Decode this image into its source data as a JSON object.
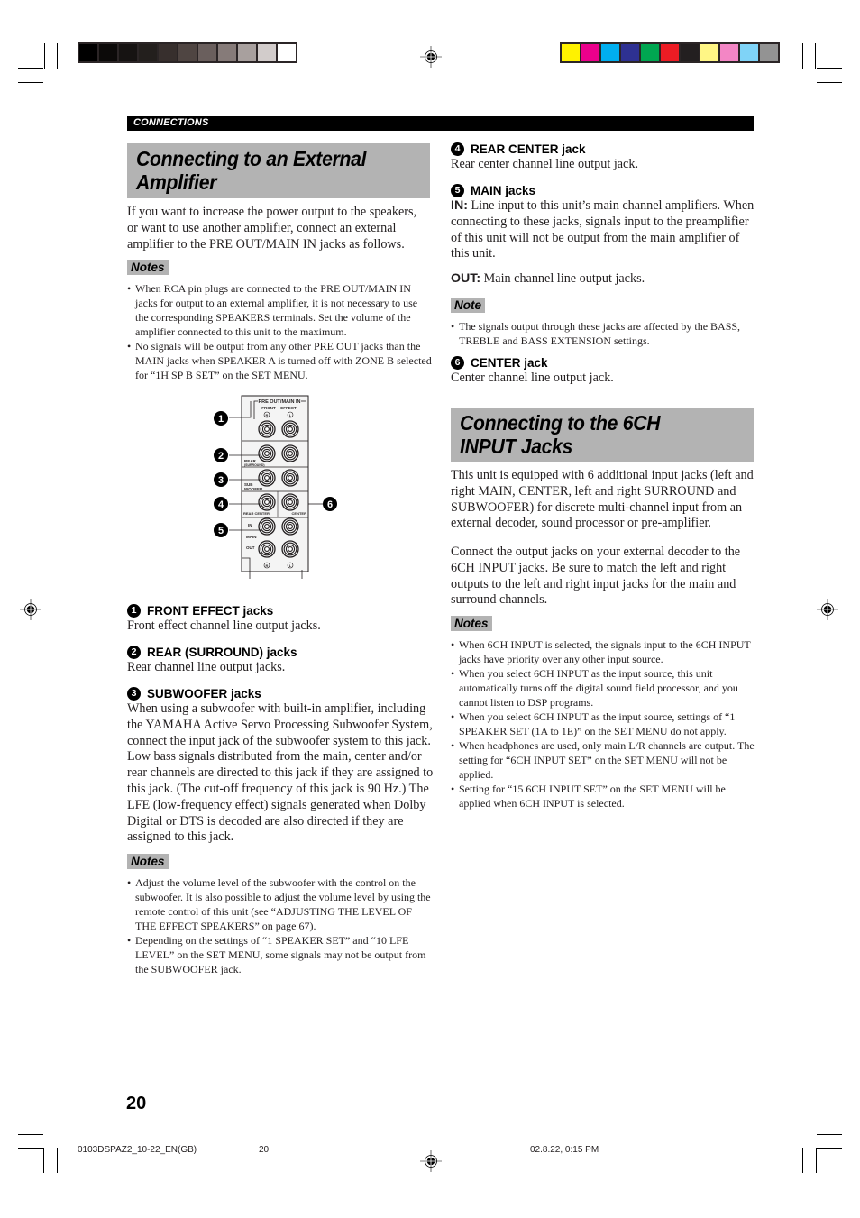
{
  "color_bars": {
    "grayscale": [
      "#000000",
      "#0c0a09",
      "#161312",
      "#231f1d",
      "#372f2d",
      "#4f4542",
      "#6a5f5d",
      "#867b79",
      "#a8a09e",
      "#d2cccb",
      "#ffffff"
    ],
    "process": [
      "#fff200",
      "#ec008c",
      "#00aeef",
      "#2e3192",
      "#00a651",
      "#ed1c24",
      "#231f20",
      "#fff685",
      "#f386c5",
      "#7fd3f7",
      "#939393"
    ]
  },
  "header": {
    "section": "CONNECTIONS"
  },
  "left": {
    "title": "Connecting to an External Amplifier",
    "intro": "If you want to increase the power output to the speakers, or want to use another amplifier, connect an external amplifier to the PRE OUT/MAIN IN jacks as follows.",
    "notes1": {
      "label": "Notes",
      "items": [
        "When RCA pin plugs are connected to the PRE OUT/MAIN IN jacks for output to an external amplifier, it is not necessary to use the corresponding SPEAKERS terminals. Set the volume of the amplifier connected to this unit to the maximum.",
        "No signals will be output from any other PRE OUT jacks than the MAIN jacks when SPEAKER A is turned off with ZONE B selected for “1H SP B SET” on the SET MENU."
      ]
    },
    "diagram": {
      "panel_title": "PRE OUT/MAIN IN",
      "front": "FRONT",
      "effect": "EFFECT",
      "rear": "REAR",
      "surround": "(SURROUND)",
      "sub": "SUB",
      "woofer": "WOOFER",
      "rear_center": "REAR CENTER",
      "center": "CENTER",
      "in": "IN",
      "main": "MAIN",
      "out": "OUT",
      "r": "R",
      "l": "L",
      "callouts": [
        "1",
        "2",
        "3",
        "4",
        "5",
        "6"
      ]
    },
    "sections": [
      {
        "num": "1",
        "heading": "FRONT EFFECT jacks",
        "text": "Front effect channel line output jacks."
      },
      {
        "num": "2",
        "heading": "REAR (SURROUND) jacks",
        "text": "Rear channel line output jacks."
      },
      {
        "num": "3",
        "heading": "SUBWOOFER jacks",
        "text": "When using a subwoofer with built-in amplifier, including the YAMAHA Active Servo Processing Subwoofer System, connect the input jack of the subwoofer system to this jack. Low bass signals distributed from the main, center and/or rear channels are directed to this jack if they are assigned to this jack. (The cut-off frequency of this jack is 90 Hz.) The LFE (low-frequency effect) signals generated when Dolby Digital or DTS is decoded are also directed if they are assigned to this jack."
      }
    ],
    "notes2": {
      "label": "Notes",
      "items": [
        "Adjust the volume level of the subwoofer with the control on the subwoofer. It is also possible to adjust the volume level by using the remote control of this unit (see “ADJUSTING THE LEVEL OF THE EFFECT SPEAKERS” on page 67).",
        "Depending on the settings of “1 SPEAKER SET” and “10 LFE LEVEL” on the SET MENU, some signals may not be output from the SUBWOOFER jack."
      ]
    }
  },
  "right": {
    "rear_center": {
      "num": "4",
      "heading": "REAR CENTER jack",
      "text": "Rear center channel line output jack."
    },
    "main": {
      "num": "5",
      "heading": "MAIN jacks",
      "in_label": "IN:",
      "in_text": "Line input to this unit’s main channel amplifiers. When connecting to these jacks, signals input to the preamplifier of this unit will not be output from the main amplifier of this unit.",
      "out_label": "OUT:",
      "out_text": "Main channel line output jacks."
    },
    "note": {
      "label": "Note",
      "items": [
        "The signals output through these jacks are affected by the BASS, TREBLE and BASS EXTENSION settings."
      ]
    },
    "center": {
      "num": "6",
      "heading": "CENTER jack",
      "text": "Center channel line output jack."
    },
    "title2": "Connecting to the 6CH INPUT Jacks",
    "para1": "This unit is equipped with 6 additional input jacks (left and right MAIN, CENTER, left and right SURROUND and SUBWOOFER) for discrete multi-channel input from an external decoder, sound processor or pre-amplifier.",
    "para2": "Connect the output jacks on your external decoder to the 6CH INPUT jacks. Be sure to match the left and right outputs to the left and right input jacks for the main and surround channels.",
    "notes3": {
      "label": "Notes",
      "items": [
        "When 6CH INPUT is selected, the signals input to the 6CH INPUT jacks have priority over any other input source.",
        "When you select 6CH INPUT as the input source, this unit automatically turns off the digital sound field processor, and you cannot listen to DSP programs.",
        "When you select 6CH INPUT as the input source, settings of “1 SPEAKER SET (1A to 1E)” on the SET MENU do not apply.",
        "When headphones are used, only main L/R channels are output. The setting for “6CH INPUT SET” on the SET MENU will not be applied.",
        "Setting for “15 6CH INPUT SET” on the SET MENU will be applied when 6CH INPUT is selected."
      ]
    }
  },
  "page_number": "20",
  "footer": {
    "file": "0103DSPAZ2_10-22_EN(GB)",
    "page": "20",
    "timestamp": "02.8.22, 0:15 PM"
  }
}
